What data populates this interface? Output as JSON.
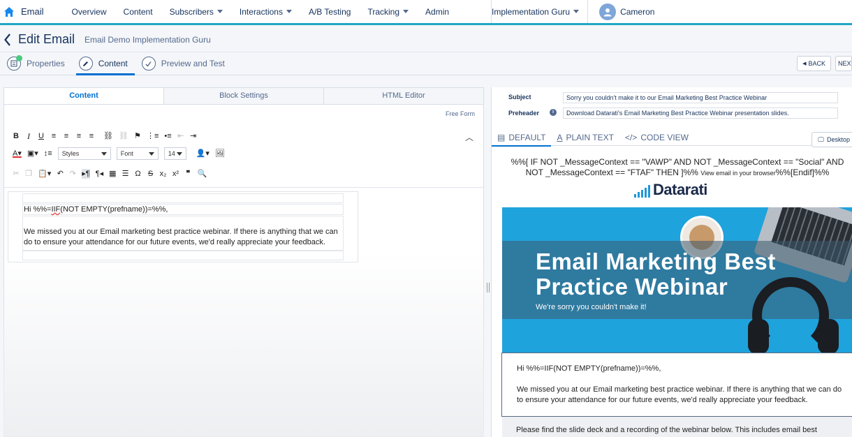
{
  "topnav": {
    "app": "Email",
    "items": [
      {
        "label": "Overview",
        "dropdown": false
      },
      {
        "label": "Content",
        "dropdown": false
      },
      {
        "label": "Subscribers",
        "dropdown": true
      },
      {
        "label": "Interactions",
        "dropdown": true
      },
      {
        "label": "A/B Testing",
        "dropdown": false
      },
      {
        "label": "Tracking",
        "dropdown": true
      },
      {
        "label": "Admin",
        "dropdown": false
      }
    ],
    "business_unit": "Implementation Guru",
    "user": "Cameron P"
  },
  "editbar": {
    "title": "Edit Email",
    "subtitle": "Email Demo Implementation Guru"
  },
  "steps": [
    {
      "label": "Properties",
      "icon": "properties-icon"
    },
    {
      "label": "Content",
      "icon": "pencil-icon"
    },
    {
      "label": "Preview and Test",
      "icon": "check-icon"
    }
  ],
  "nav_buttons": {
    "back": "BACK",
    "next": "NEXT"
  },
  "left": {
    "tabs": [
      "Content",
      "Block Settings",
      "HTML Editor"
    ],
    "free_form": "Free Form",
    "styles_select": "Styles",
    "font_select": "Font",
    "size_select": "14",
    "greeting_prefix": "Hi %%=",
    "greeting_fn": "IIF",
    "greeting_suffix": "(NOT EMPTY(prefname))=%%,",
    "paragraph": "We missed you at our Email marketing best practice webinar. If there is anything that we can do to ensure your attendance for our future events, we'd really appreciate your feedback."
  },
  "right": {
    "subject_label": "Subject",
    "subject_value": "Sorry you couldn't make it to our Email Marketing Best Practice Webinar",
    "preheader_label": "Preheader",
    "preheader_value": "Download Datarati's Email Marketing Best Practice Webinar presentation slides.",
    "view_tabs": [
      "DEFAULT",
      "PLAIN TEXT",
      "CODE VIEW"
    ],
    "desktop_btn": "Desktop",
    "amp_line1": "%%[ IF NOT _MessageContext == \"VAWP\" AND NOT _MessageContext == \"Social\" AND",
    "amp_line2a": "NOT _MessageContext == \"FTAF\" THEN ]%% ",
    "amp_line2_small": "View email in your browser",
    "amp_line2b": "%%[Endif]%%",
    "logo": "Datarati",
    "hero_title": "Email Marketing Best Practice Webinar",
    "hero_sub": "We're sorry you couldn't make it!",
    "body_greeting": "Hi %%=IIF(NOT EMPTY(prefname))=%%,",
    "body_paragraph": "We missed you at our Email marketing best practice webinar. If there is anything that we can do to ensure your attendance for our future events, we'd really appreciate your feedback.",
    "grey_text": "Please find the slide deck and a recording of the webinar below. This includes email best"
  }
}
